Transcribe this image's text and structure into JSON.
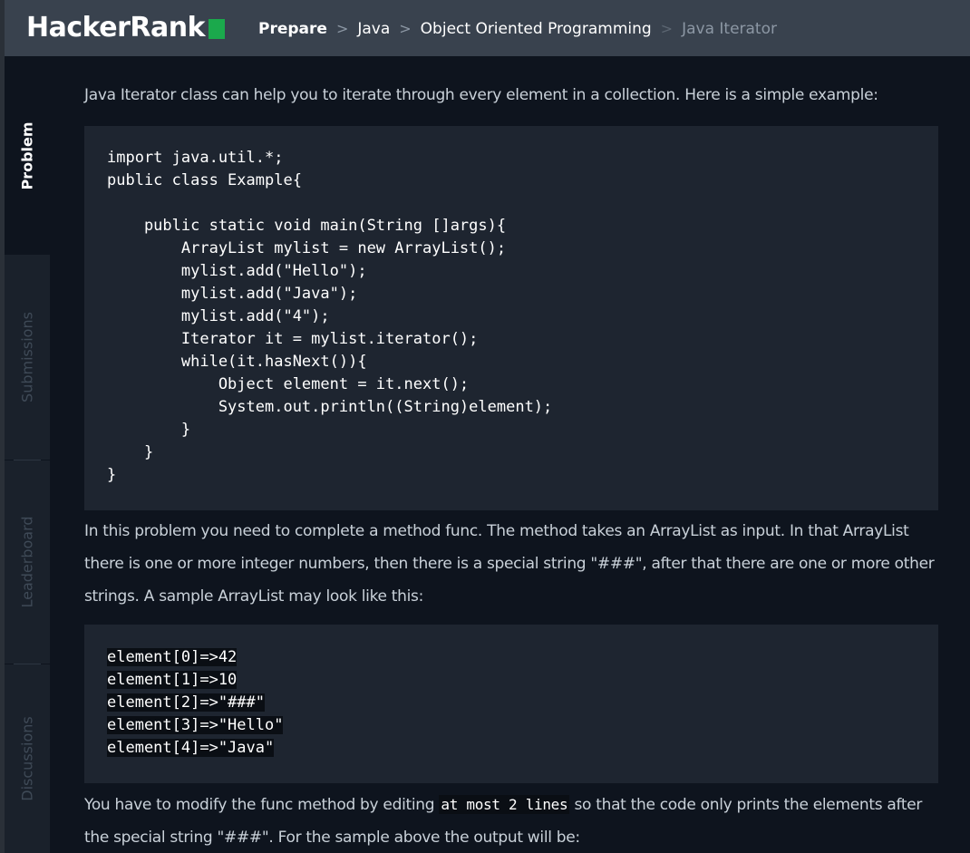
{
  "header": {
    "logo_text": "HackerRank",
    "breadcrumb": {
      "prepare": "Prepare",
      "sep": ">",
      "language": "Java",
      "category": "Object Oriented Programming",
      "current": "Java Iterator"
    }
  },
  "sidebar": {
    "tabs": [
      {
        "label": "Problem",
        "active": true
      },
      {
        "label": "Submissions",
        "active": false
      },
      {
        "label": "Leaderboard",
        "active": false
      },
      {
        "label": "Discussions",
        "active": false
      }
    ]
  },
  "problem": {
    "intro": "Java Iterator class can help you to iterate through every element in a collection. Here is a simple example:",
    "example_code": "import java.util.*;\npublic class Example{\n\n    public static void main(String []args){\n        ArrayList mylist = new ArrayList();\n        mylist.add(\"Hello\");\n        mylist.add(\"Java\");\n        mylist.add(\"4\");\n        Iterator it = mylist.iterator();\n        while(it.hasNext()){\n            Object element = it.next();\n            System.out.println((String)element);\n        }\n    }\n}",
    "description": "In this problem you need to complete a method func. The method takes an ArrayList as input. In that ArrayList there is one or more integer numbers, then there is a special string \"###\", after that there are one or more other strings. A sample ArrayList may look like this:",
    "sample_lines": [
      "element[0]=>42",
      "element[1]=>10",
      "element[2]=>\"###\"",
      "element[3]=>\"Hello\"",
      "element[4]=>\"Java\""
    ],
    "task_before": "You have to modify the func method by editing ",
    "task_code": "at most 2 lines",
    "task_after": " so that the code only prints the elements after the special string \"###\". For the sample above the output will be:"
  }
}
